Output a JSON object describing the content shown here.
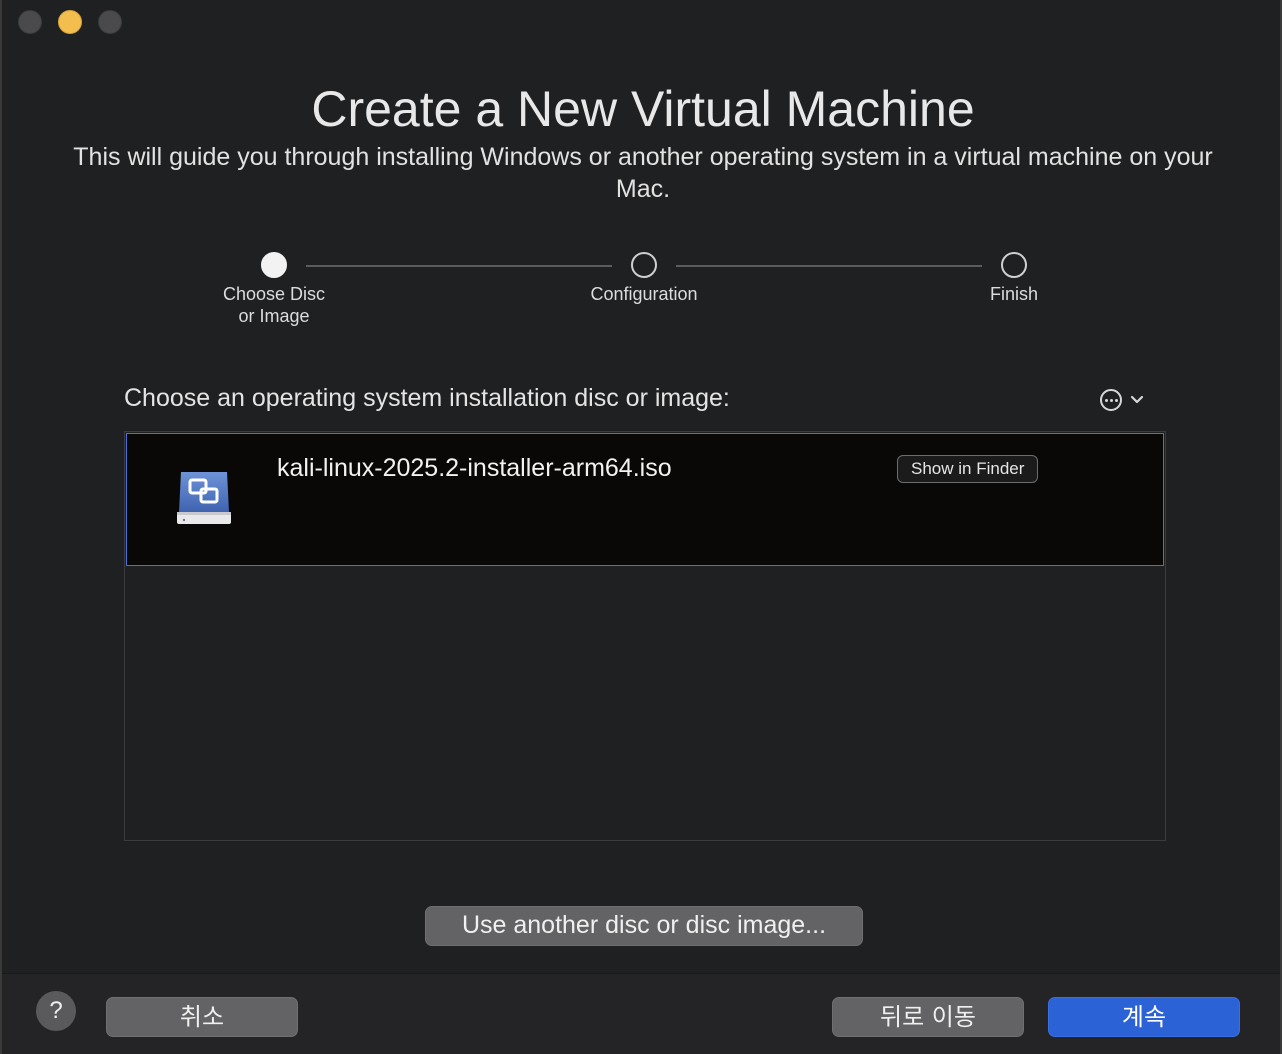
{
  "window": {
    "title": "Create a New Virtual Machine",
    "subtitle": "This will guide you through installing Windows or another operating system in a virtual machine on your Mac."
  },
  "steps": [
    {
      "label": "Choose Disc\nor Image",
      "state": "active"
    },
    {
      "label": "Configuration",
      "state": "pending"
    },
    {
      "label": "Finish",
      "state": "pending"
    }
  ],
  "chooser": {
    "label": "Choose an operating system installation disc or image:",
    "more_icon": "ellipsis-circle-icon",
    "chevron_icon": "chevron-down-icon"
  },
  "list": {
    "items": [
      {
        "name": "kali-linux-2025.2-installer-arm64.iso",
        "icon": "disk-image-icon",
        "action_label": "Show in Finder",
        "selected": true
      }
    ]
  },
  "use_another_label": "Use another disc or disc image...",
  "footer": {
    "help_label": "?",
    "cancel_label": "취소",
    "back_label": "뒤로 이동",
    "continue_label": "계속"
  },
  "colors": {
    "accent": "#2b62d6",
    "selection_border": "#4a6fd8",
    "minimize_light": "#f4be4f"
  }
}
